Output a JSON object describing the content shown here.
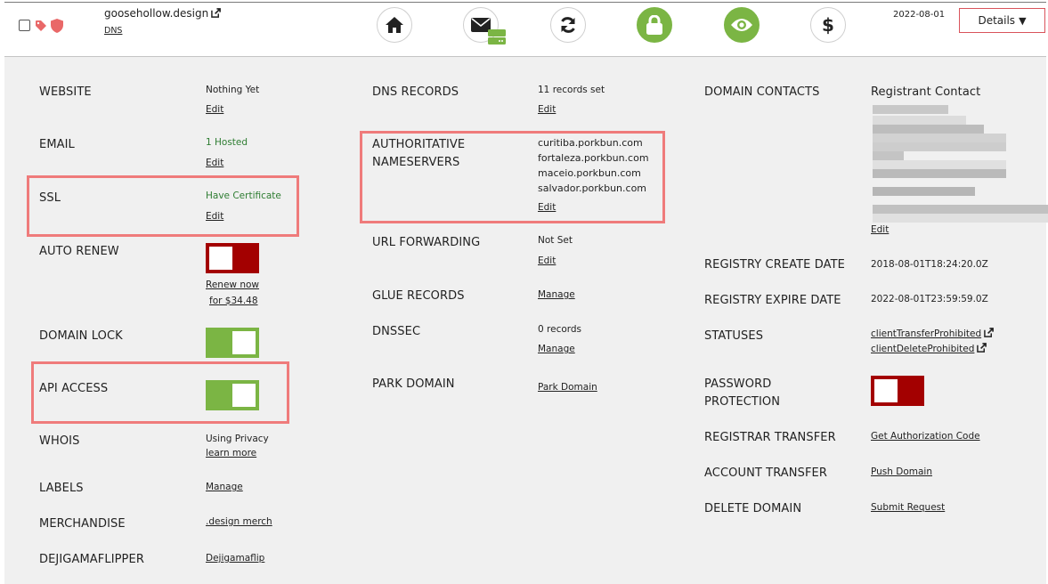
{
  "header": {
    "domain": "goosehollow.design",
    "dns_link": "DNS",
    "expiry_date": "2022-08-01",
    "details_button": "Details",
    "details_caret": "▼",
    "icons": [
      "tag-icon",
      "shield-icon",
      "home-icon",
      "mail-icon",
      "server-icon",
      "refresh-icon",
      "lock-icon",
      "eye-icon",
      "dollar-icon",
      "external-link-icon"
    ],
    "status_colors": {
      "accent_green": "#7bb544",
      "alert_red": "#e96868",
      "toggle_off_red": "#a30000",
      "highlight": "#ef7b7b"
    }
  },
  "col1": {
    "website": {
      "label": "WEBSITE",
      "value": "Nothing Yet",
      "action": "Edit"
    },
    "email": {
      "label": "EMAIL",
      "value": "1 Hosted",
      "action": "Edit"
    },
    "ssl": {
      "label": "SSL",
      "value": "Have Certificate",
      "action": "Edit"
    },
    "auto_renew": {
      "label": "AUTO RENEW",
      "state": "off",
      "renew_line1": "Renew now",
      "renew_line2": "for $34.48"
    },
    "domain_lock": {
      "label": "DOMAIN LOCK",
      "state": "on"
    },
    "api_access": {
      "label": "API ACCESS",
      "state": "on"
    },
    "whois": {
      "label": "WHOIS",
      "value": "Using Privacy",
      "action": "learn more"
    },
    "labels": {
      "label": "LABELS",
      "action": "Manage"
    },
    "merchandise": {
      "label": "MERCHANDISE",
      "action": ".design merch"
    },
    "dejigamaflipper": {
      "label": "DEJIGAMAFLIPPER",
      "action": "Dejigamaflip"
    }
  },
  "col2": {
    "dns_records": {
      "label": "DNS RECORDS",
      "value": "11 records set",
      "action": "Edit"
    },
    "nameservers": {
      "label_line1": "AUTHORITATIVE",
      "label_line2": "NAMESERVERS",
      "servers": [
        "curitiba.porkbun.com",
        "fortaleza.porkbun.com",
        "maceio.porkbun.com",
        "salvador.porkbun.com"
      ],
      "action": "Edit"
    },
    "url_forwarding": {
      "label": "URL FORWARDING",
      "value": "Not Set",
      "action": "Edit"
    },
    "glue_records": {
      "label": "GLUE RECORDS",
      "action": "Manage"
    },
    "dnssec": {
      "label": "DNSSEC",
      "value": "0 records",
      "action": "Manage"
    },
    "park_domain": {
      "label": "PARK DOMAIN",
      "action": "Park Domain"
    }
  },
  "col3": {
    "domain_contacts": {
      "label": "DOMAIN CONTACTS",
      "title": "Registrant Contact",
      "action": "Edit"
    },
    "create_date": {
      "label": "REGISTRY CREATE DATE",
      "value": "2018-08-01T18:24:20.0Z"
    },
    "expire_date": {
      "label": "REGISTRY EXPIRE DATE",
      "value": "2022-08-01T23:59:59.0Z"
    },
    "statuses": {
      "label": "STATUSES",
      "items": [
        "clientTransferProhibited",
        "clientDeleteProhibited"
      ]
    },
    "password_protection": {
      "label_line1": "PASSWORD",
      "label_line2": "PROTECTION",
      "state": "off"
    },
    "registrar_transfer": {
      "label": "REGISTRAR TRANSFER",
      "action": "Get Authorization Code"
    },
    "account_transfer": {
      "label": "ACCOUNT TRANSFER",
      "action": "Push Domain"
    },
    "delete_domain": {
      "label": "DELETE DOMAIN",
      "action": "Submit Request"
    }
  }
}
